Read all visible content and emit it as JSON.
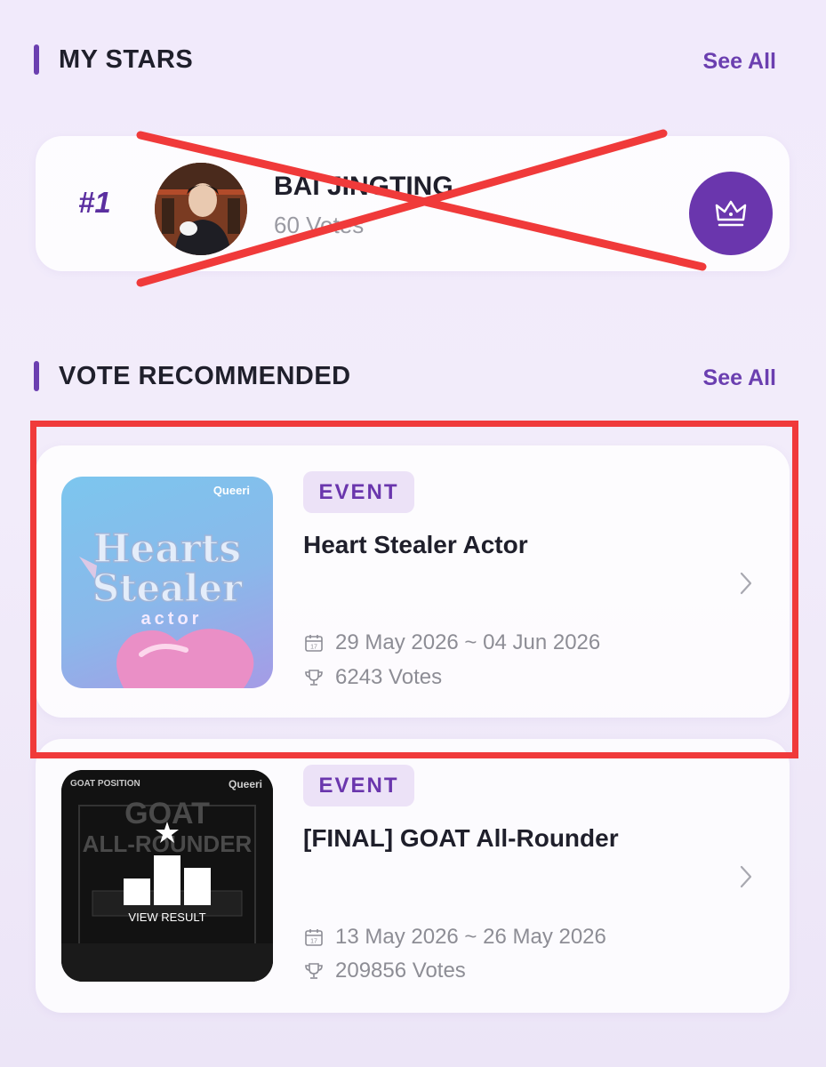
{
  "my_stars": {
    "title": "MY STARS",
    "see_all": "See All",
    "star": {
      "rank": "#1",
      "name": "BAI JINGTING",
      "votes": "60 Votes",
      "crossed_out": true
    }
  },
  "vote_recommended": {
    "title": "VOTE RECOMMENDED",
    "see_all": "See All",
    "items": [
      {
        "badge": "EVENT",
        "title": "Heart Stealer Actor",
        "date_range": "29 May 2026 ~ 04 Jun 2026",
        "votes": "6243 Votes",
        "thumb_brand": "Queeri",
        "thumb_line1": "Hearts",
        "thumb_line2": "Stealer",
        "thumb_line3": "actor",
        "highlighted": true
      },
      {
        "badge": "EVENT",
        "title": "[FINAL] GOAT All-Rounder",
        "date_range": "13 May 2026 ~ 26 May 2026",
        "votes": "209856 Votes",
        "thumb_brand": "Queeri",
        "thumb_corner": "GOAT POSITION",
        "thumb_line1": "GOAT",
        "thumb_line2": "ALL-ROUNDER",
        "thumb_overlay": "VIEW RESULT"
      }
    ]
  },
  "colors": {
    "accent": "#6b3fb0",
    "highlight": "#f03a3a",
    "badge_bg": "#ece2f7"
  },
  "icons": [
    "crown-icon",
    "calendar-icon",
    "trophy-icon",
    "chevron-right-icon"
  ]
}
